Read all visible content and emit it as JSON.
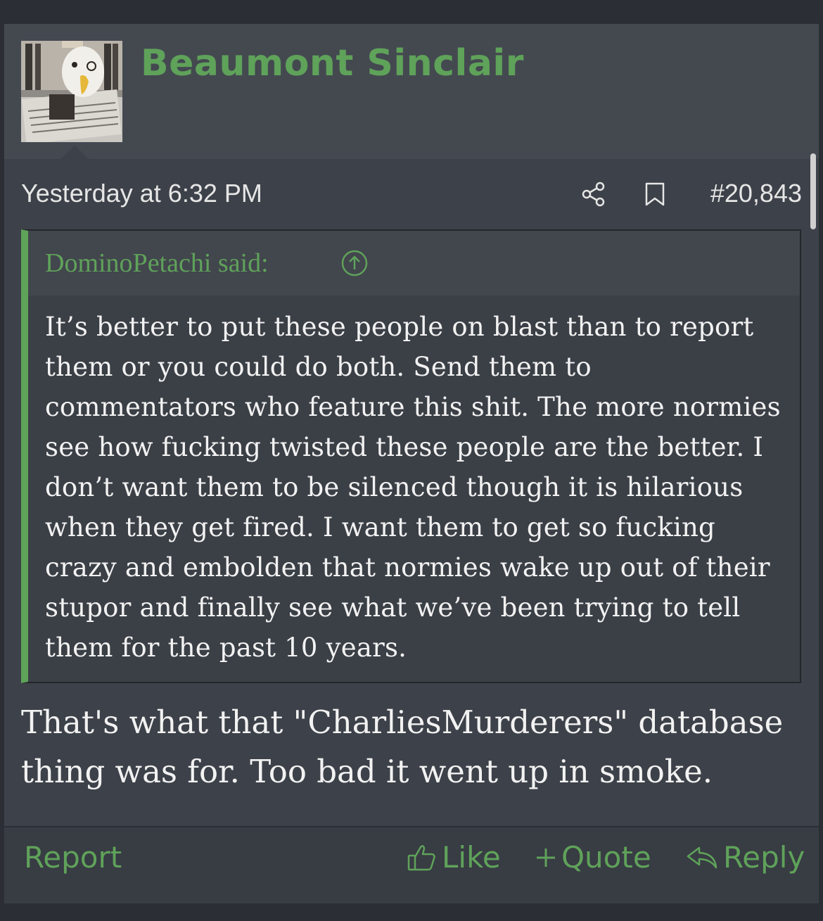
{
  "post": {
    "username": "Beaumont Sinclair",
    "timestamp": "Yesterday at 6:32 PM",
    "post_number": "#20,843",
    "icons": [
      "avatar-image",
      "share-icon",
      "bookmark-icon"
    ],
    "quote": {
      "author_line": "DominoPetachi said:",
      "jump_icon": "arrow-up-circle-icon",
      "body": "It’s better to put these people on blast than to report them or you could do both. Send them to commentators who feature this shit. The more normies see how fucking twisted these people are the better. I don’t want them to be silenced though it is hilarious when they get fired. I want them to get so fucking crazy and embolden that normies wake up out of their stupor and finally see what we’ve been trying to tell them for the past 10 years."
    },
    "reply_text": "That's what that \"CharliesMurderers\" database thing was for. Too bad it went up in smoke."
  },
  "footer": {
    "report_label": "Report",
    "like_label": "Like",
    "quote_label": "Quote",
    "reply_label": "Reply"
  },
  "colors": {
    "accent": "#5fa25a",
    "background": "#3d4149",
    "header": "#444950",
    "text": "#f2f2f2"
  }
}
